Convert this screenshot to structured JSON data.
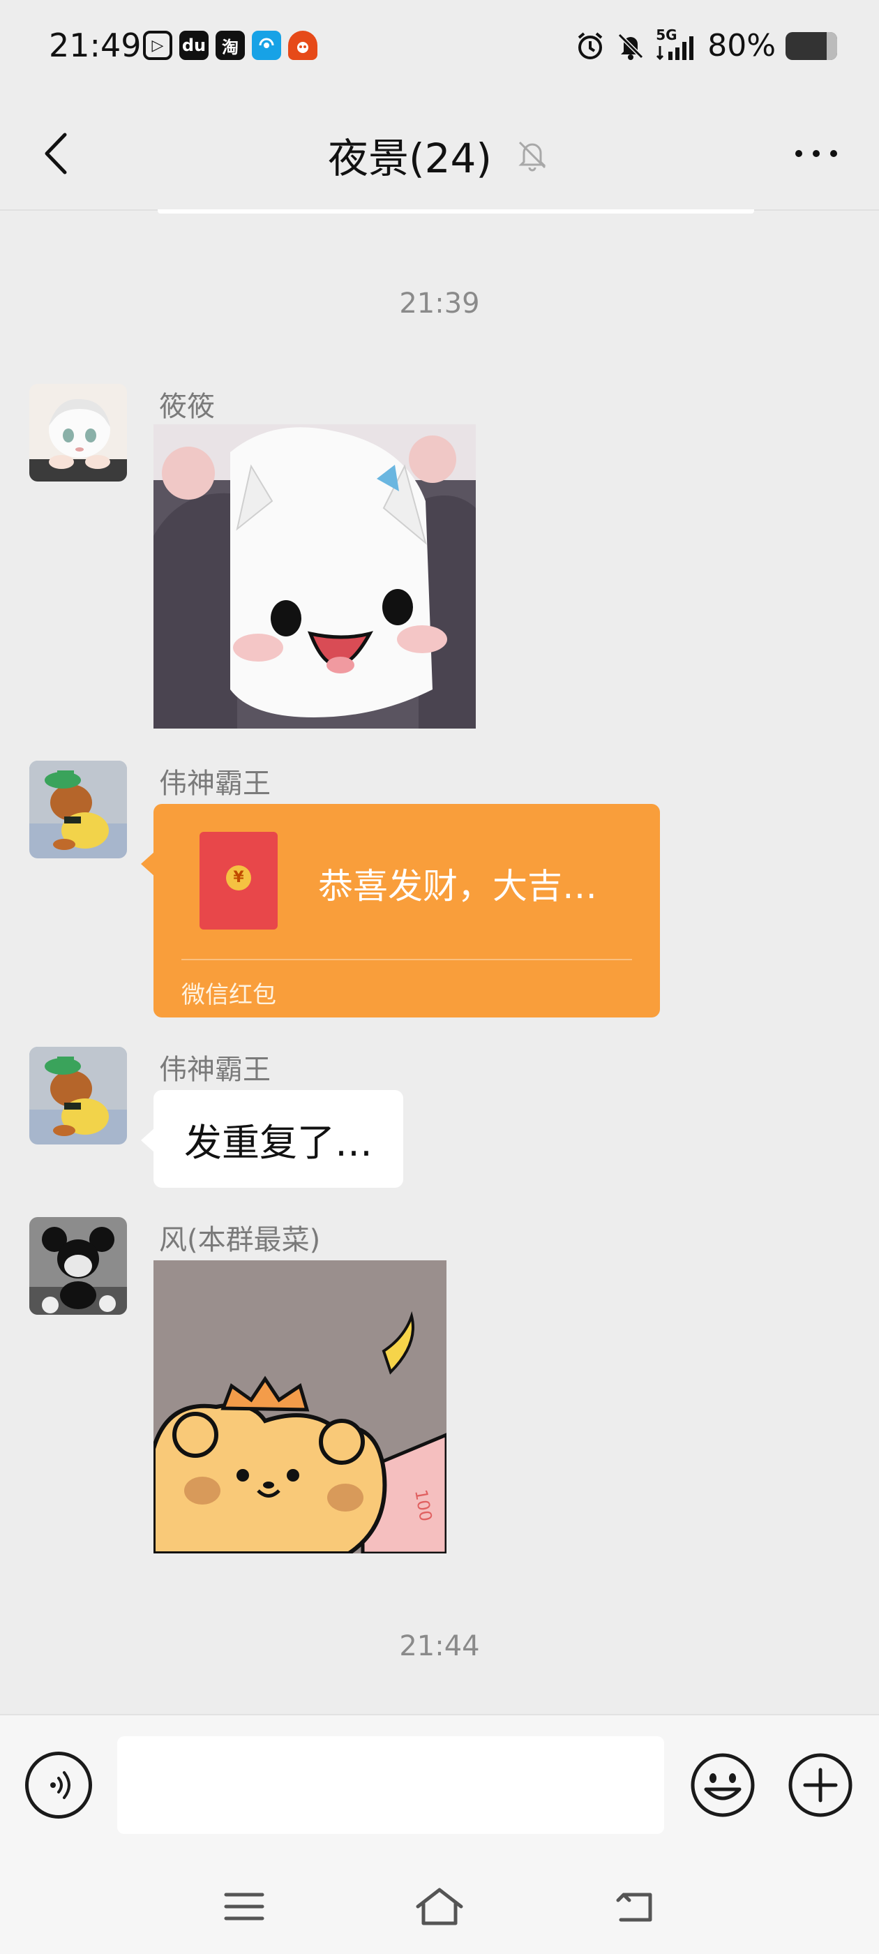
{
  "status_bar": {
    "time": "21:49",
    "apps": [
      "▷",
      "du",
      "淘",
      "wifi",
      "fire"
    ],
    "network": "5G",
    "battery_text": "80%",
    "battery_level": 0.8
  },
  "nav": {
    "title": "夜景(24)",
    "muted": true
  },
  "chat": {
    "timestamps": [
      "21:39",
      "21:44"
    ],
    "messages": [
      {
        "sender": "筱筱",
        "type": "sticker",
        "sticker_icon": "anime-girl-sticker"
      },
      {
        "sender": "伟神霸王",
        "type": "red_packet",
        "text": "恭喜发财，大吉…",
        "label": "微信红包",
        "coin": "¥"
      },
      {
        "sender": "伟神霸王",
        "type": "text",
        "text": "发重复了…"
      },
      {
        "sender": "风(本群最菜)",
        "type": "sticker",
        "sticker_icon": "bear-crown-sticker"
      }
    ]
  },
  "input_bar": {
    "value": "",
    "placeholder": ""
  },
  "colors": {
    "background": "#ededed",
    "red_packet": "#f99e3b",
    "red_envelope": "#e8474a",
    "bubble": "#ffffff"
  }
}
